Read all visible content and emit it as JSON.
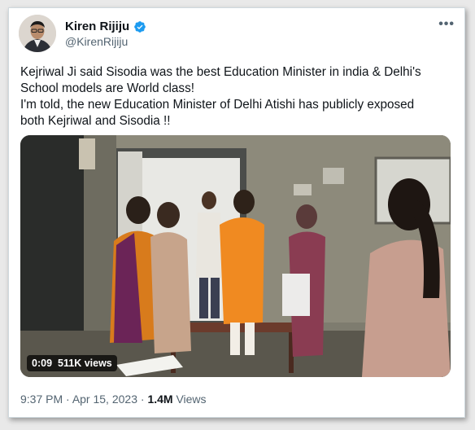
{
  "author": {
    "name": "Kiren Rijiju",
    "handle": "@KirenRijiju"
  },
  "tweet": {
    "lines": [
      "Kejriwal Ji said Sisodia was the best Education Minister in india & Delhi's",
      "School models are World class!",
      "I'm told, the new Education Minister of Delhi Atishi has publicly exposed",
      "both Kejriwal and Sisodia !!"
    ]
  },
  "video": {
    "duration": "0:09",
    "views": "511K views"
  },
  "meta": {
    "time": "9:37 PM",
    "separator1": " · ",
    "date": "Apr 15, 2023",
    "separator2": " · ",
    "views_count": "1.4M",
    "views_label": " Views"
  },
  "colors": {
    "verified": "#1d9bf0",
    "secondary_text": "#536471",
    "primary_text": "#0f1419"
  },
  "icons": [
    "verified-badge-icon",
    "more-icon"
  ]
}
